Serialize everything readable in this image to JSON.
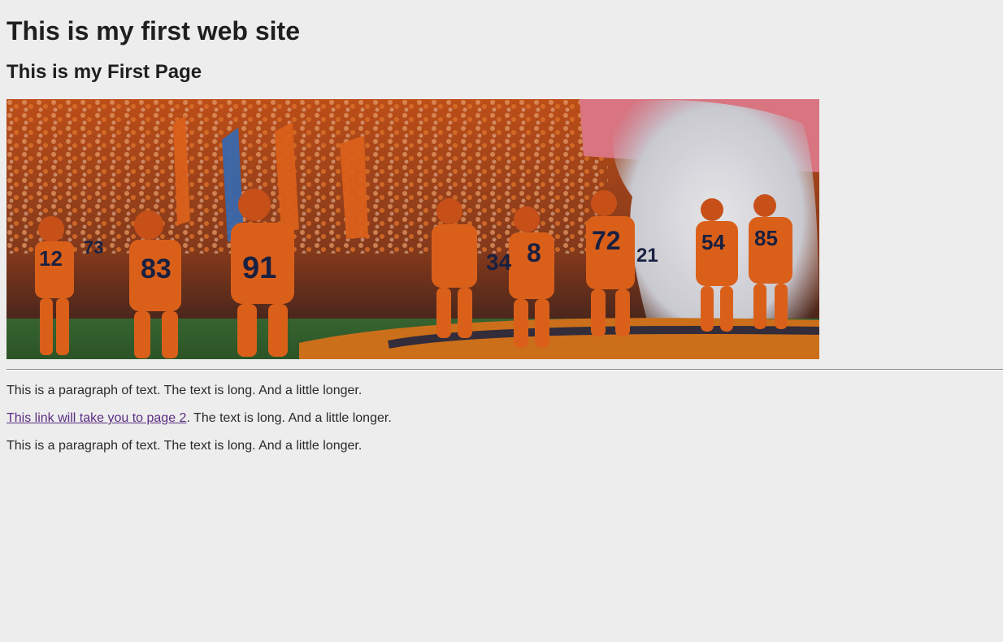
{
  "page": {
    "heading_main": "This is my first web site",
    "heading_sub": "This is my First Page",
    "hero_image": {
      "alt": "Syracuse football team running onto the field",
      "jersey_numbers": [
        "12",
        "83",
        "91",
        "34",
        "8",
        "72",
        "21",
        "54",
        "85",
        "73"
      ],
      "colors": {
        "uniform_orange": "#e8661c",
        "helmet_orange": "#d4561a",
        "navy": "#1b2344",
        "field_green": "#3f7a3a",
        "smoke": "#e9e9ee",
        "banner_pink": "#e77c8a"
      }
    },
    "paragraphs": {
      "p1": "This is a paragraph of text. The text is long. And a little longer.",
      "p2_link": "This link will take you to page 2",
      "p2_rest": ". The text is long. And a little longer.",
      "p3": "This is a paragraph of text. The text is long. And a little longer."
    }
  },
  "style": {
    "background": "#ededed",
    "link_color": "#5a2d82"
  }
}
